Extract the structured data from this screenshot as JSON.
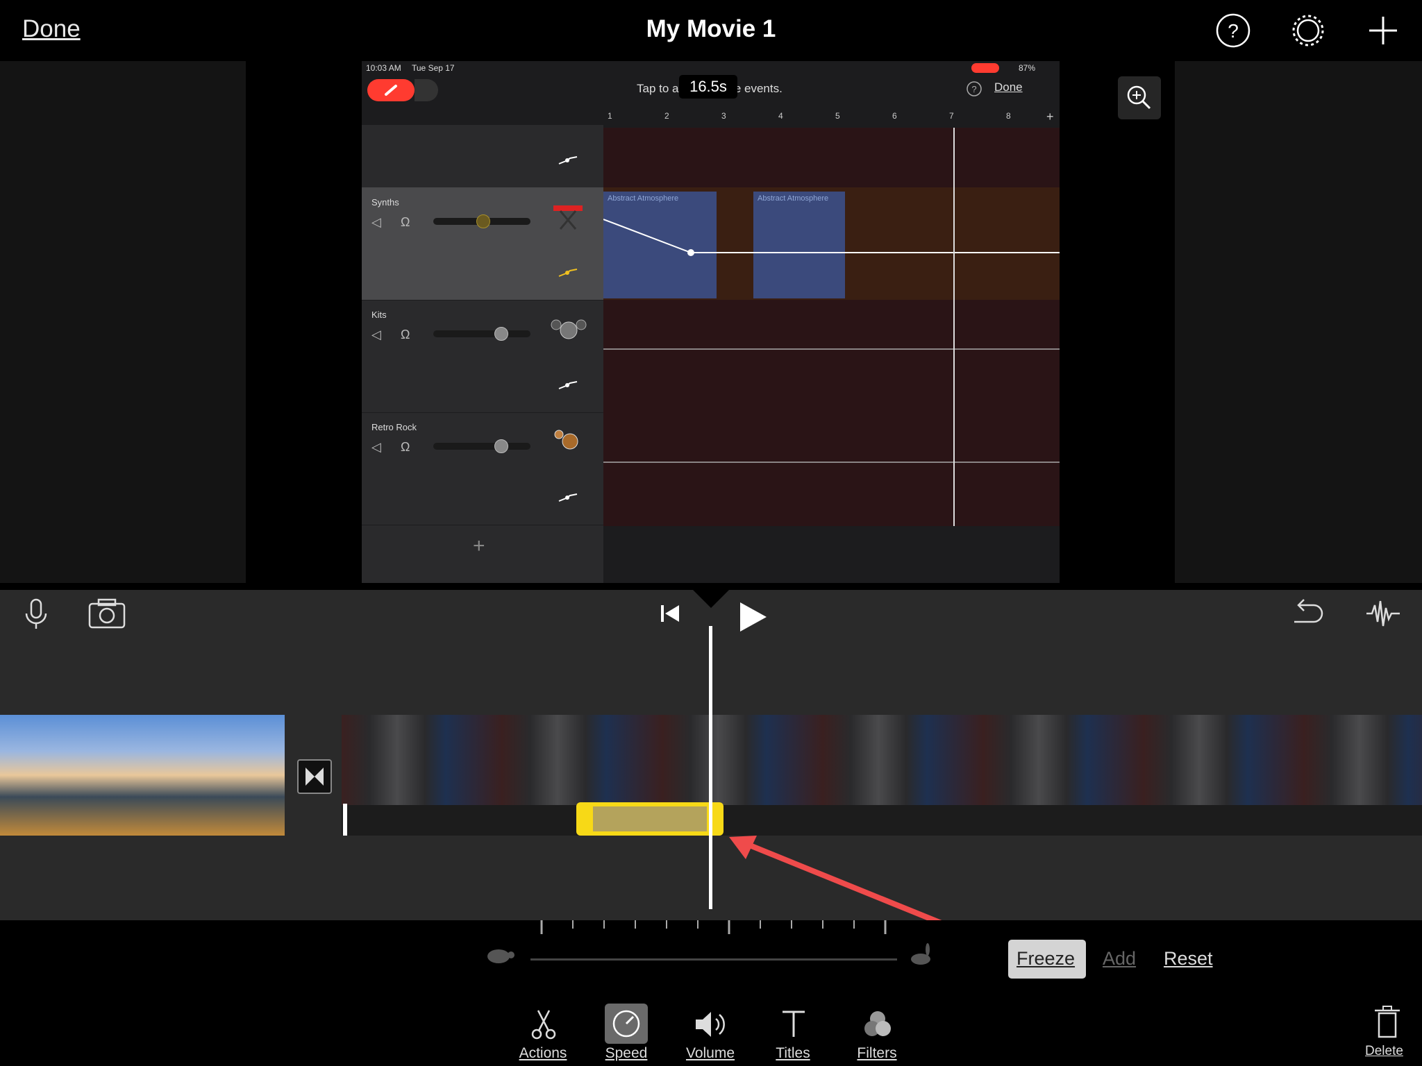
{
  "header": {
    "done_label": "Done",
    "title": "My Movie 1",
    "icons": [
      "help-icon",
      "settings-icon",
      "add-icon"
    ]
  },
  "garageband": {
    "status_time": "10:03 AM",
    "status_date": "Tue Sep 17",
    "battery": "87%",
    "hint": "Tap to add or delete events.",
    "done_label": "Done",
    "timecode": "16.5s",
    "ruler_marks": [
      "1",
      "2",
      "3",
      "4",
      "5",
      "6",
      "7",
      "8"
    ],
    "tracks": [
      {
        "name": "",
        "selected": false
      },
      {
        "name": "Synths",
        "selected": true,
        "volume": 0.5
      },
      {
        "name": "Kits",
        "selected": false,
        "volume": 0.7
      },
      {
        "name": "Retro Rock",
        "selected": false,
        "volume": 0.7
      }
    ],
    "regions": [
      {
        "label": "Abstract Atmosphere"
      },
      {
        "label": "Abstract Atmosphere"
      }
    ]
  },
  "timeline": {
    "controls": [
      "microphone-icon",
      "camera-icon",
      "skip-back-icon",
      "play-icon",
      "undo-icon",
      "waveform-icon"
    ]
  },
  "speed": {
    "freeze_label": "Freeze",
    "add_label": "Add",
    "reset_label": "Reset"
  },
  "tabs": [
    {
      "label": "Actions",
      "icon": "scissors-icon"
    },
    {
      "label": "Speed",
      "icon": "speedometer-icon",
      "active": true
    },
    {
      "label": "Volume",
      "icon": "speaker-icon"
    },
    {
      "label": "Titles",
      "icon": "text-icon"
    },
    {
      "label": "Filters",
      "icon": "filters-icon"
    }
  ],
  "delete_label": "Delete",
  "colors": {
    "accent_yellow": "#f7d917",
    "annotation_red": "#ef4b4b",
    "record_red": "#ff3b30"
  }
}
